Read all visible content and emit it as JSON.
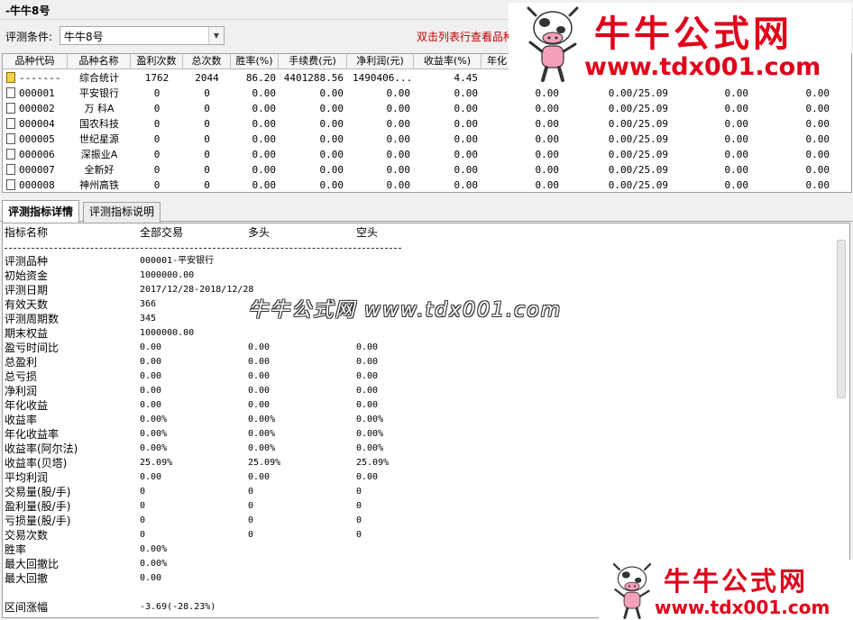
{
  "window": {
    "title": "-牛牛8号"
  },
  "toolbar": {
    "condition_label": "评测条件:",
    "condition_value": "牛牛8号",
    "hint": "双击列表行查看品种"
  },
  "grid": {
    "columns": [
      "品种代码",
      "品种名称",
      "盈利次数",
      "总次数",
      "胜率(%)",
      "手续费(元)",
      "净利润(元)",
      "收益率(%)",
      "年化"
    ],
    "summary": {
      "code": "-------",
      "name": "综合统计",
      "wins": "1762",
      "total": "2044",
      "winrate": "86.20",
      "fee": "4401288.56",
      "profit": "1490406...",
      "return": "4.45"
    },
    "rows": [
      {
        "code": "000001",
        "name": "平安银行",
        "wins": "0",
        "total": "0",
        "winrate": "0.00",
        "fee": "0.00",
        "profit": "0.00",
        "return": "0.00",
        "c9": "0.00",
        "c10": "0.00/25.09",
        "c11": "0.00",
        "c12": "0.00"
      },
      {
        "code": "000002",
        "name": "万 科A",
        "wins": "0",
        "total": "0",
        "winrate": "0.00",
        "fee": "0.00",
        "profit": "0.00",
        "return": "0.00",
        "c9": "0.00",
        "c10": "0.00/25.09",
        "c11": "0.00",
        "c12": "0.00"
      },
      {
        "code": "000004",
        "name": "国农科技",
        "wins": "0",
        "total": "0",
        "winrate": "0.00",
        "fee": "0.00",
        "profit": "0.00",
        "return": "0.00",
        "c9": "0.00",
        "c10": "0.00/25.09",
        "c11": "0.00",
        "c12": "0.00"
      },
      {
        "code": "000005",
        "name": "世纪星源",
        "wins": "0",
        "total": "0",
        "winrate": "0.00",
        "fee": "0.00",
        "profit": "0.00",
        "return": "0.00",
        "c9": "0.00",
        "c10": "0.00/25.09",
        "c11": "0.00",
        "c12": "0.00"
      },
      {
        "code": "000006",
        "name": "深振业A",
        "wins": "0",
        "total": "0",
        "winrate": "0.00",
        "fee": "0.00",
        "profit": "0.00",
        "return": "0.00",
        "c9": "0.00",
        "c10": "0.00/25.09",
        "c11": "0.00",
        "c12": "0.00"
      },
      {
        "code": "000007",
        "name": "全新好",
        "wins": "0",
        "total": "0",
        "winrate": "0.00",
        "fee": "0.00",
        "profit": "0.00",
        "return": "0.00",
        "c9": "0.00",
        "c10": "0.00/25.09",
        "c11": "0.00",
        "c12": "0.00"
      },
      {
        "code": "000008",
        "name": "神州高铁",
        "wins": "0",
        "total": "0",
        "winrate": "0.00",
        "fee": "0.00",
        "profit": "0.00",
        "return": "0.00",
        "c9": "0.00",
        "c10": "0.00/25.09",
        "c11": "0.00",
        "c12": "0.00"
      }
    ]
  },
  "tabs": [
    {
      "label": "评测指标详情",
      "active": true
    },
    {
      "label": "评测指标说明",
      "active": false
    }
  ],
  "detail": {
    "header": {
      "name": "指标名称",
      "all": "全部交易",
      "long": "多头",
      "short": "空头"
    },
    "separator": "------------------------------------------------------------------------------------------------",
    "info": [
      {
        "label": "评测品种",
        "value": "000001-平安银行"
      },
      {
        "label": "初始资金",
        "value": "1000000.00"
      },
      {
        "label": "评测日期",
        "value": "2017/12/28-2018/12/28"
      },
      {
        "label": "有效天数",
        "value": "366"
      },
      {
        "label": "评测周期数",
        "value": "345"
      },
      {
        "label": "期末权益",
        "value": "1000000.00"
      }
    ],
    "metrics": [
      {
        "label": "盈亏时间比",
        "all": "0.00",
        "long": "0.00",
        "short": "0.00"
      },
      {
        "label": "总盈利",
        "all": "0.00",
        "long": "0.00",
        "short": "0.00"
      },
      {
        "label": "总亏损",
        "all": "0.00",
        "long": "0.00",
        "short": "0.00"
      },
      {
        "label": "净利润",
        "all": "0.00",
        "long": "0.00",
        "short": "0.00"
      },
      {
        "label": "年化收益",
        "all": "0.00",
        "long": "0.00",
        "short": "0.00"
      },
      {
        "label": "收益率",
        "all": "0.00%",
        "long": "0.00%",
        "short": "0.00%"
      },
      {
        "label": "年化收益率",
        "all": "0.00%",
        "long": "0.00%",
        "short": "0.00%"
      },
      {
        "label": "收益率(阿尔法)",
        "all": "0.00%",
        "long": "0.00%",
        "short": "0.00%"
      },
      {
        "label": "收益率(贝塔)",
        "all": "25.09%",
        "long": "25.09%",
        "short": "25.09%"
      },
      {
        "label": "平均利润",
        "all": "0.00",
        "long": "0.00",
        "short": "0.00"
      },
      {
        "label": "交易量(股/手)",
        "all": "0",
        "long": "0",
        "short": "0"
      },
      {
        "label": "盈利量(股/手)",
        "all": "0",
        "long": "0",
        "short": "0"
      },
      {
        "label": "亏损量(股/手)",
        "all": "0",
        "long": "0",
        "short": "0"
      },
      {
        "label": "交易次数",
        "all": "0",
        "long": "0",
        "short": "0"
      },
      {
        "label": "胜率",
        "all": "0.00%",
        "long": "",
        "short": ""
      },
      {
        "label": "最大回撤比",
        "all": "0.00%",
        "long": "",
        "short": ""
      },
      {
        "label": "最大回撤",
        "all": "0.00",
        "long": "",
        "short": ""
      }
    ],
    "range": {
      "label": "区间涨幅",
      "value": "-3.69(-28.23%)"
    }
  },
  "watermark": "牛牛公式网 www.tdx001.com",
  "logo": {
    "brand": "牛牛公式网",
    "url": "www.tdx001.com",
    "icon": "cow-mascot-icon"
  },
  "colors": {
    "hint": "#c00000",
    "brand": "#e0001a"
  }
}
